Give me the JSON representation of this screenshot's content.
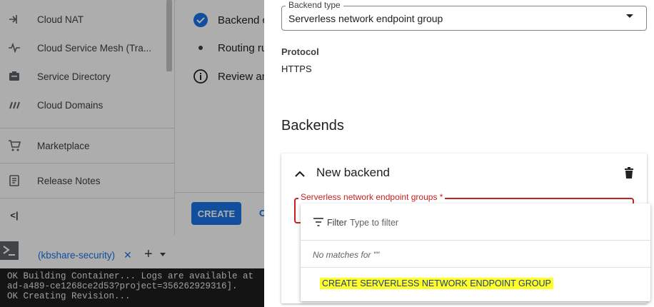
{
  "sidebar": {
    "items": [
      {
        "label": "Cloud NAT",
        "icon": "nat-icon"
      },
      {
        "label": "Cloud Service Mesh (Tra...",
        "icon": "service-mesh-icon"
      },
      {
        "label": "Service Directory",
        "icon": "service-directory-icon"
      },
      {
        "label": "Cloud Domains",
        "icon": "domains-icon"
      },
      {
        "label": "Marketplace",
        "icon": "cart-icon"
      },
      {
        "label": "Release Notes",
        "icon": "notes-icon"
      }
    ],
    "collapse_label": "<|"
  },
  "stepper": {
    "steps": [
      {
        "label": "Backend c",
        "state": "done"
      },
      {
        "label": "Routing ru",
        "state": "pending"
      },
      {
        "label": "Review an",
        "state": "info"
      }
    ],
    "create_label": "CREATE",
    "cancel_fragment": "C"
  },
  "shell": {
    "tab_label": "(kbshare-security)",
    "close_glyph": "✕",
    "add_glyph": "+",
    "terminal_lines": [
      "OK Building Container... Logs are available at",
      "ad-a489-ce1268ce2d53?project=356262929316].",
      "OK Creating Revision..."
    ]
  },
  "form": {
    "backend_type": {
      "legend": "Backend type",
      "value": "Serverless network endpoint group"
    },
    "protocol": {
      "label": "Protocol",
      "value": "HTTPS"
    },
    "backends_heading": "Backends",
    "new_backend_title": "New backend",
    "neg_field": {
      "legend": "Serverless network endpoint groups *"
    },
    "dropdown": {
      "filter_label": "Filter",
      "filter_placeholder": "Type to filter",
      "no_matches": "No matches for \"\"",
      "create_option": "CREATE SERVERLESS NETWORK ENDPOINT GROUP"
    }
  },
  "colors": {
    "accent": "#1a73e8",
    "error": "#c5221f",
    "highlight": "#ffff24"
  }
}
